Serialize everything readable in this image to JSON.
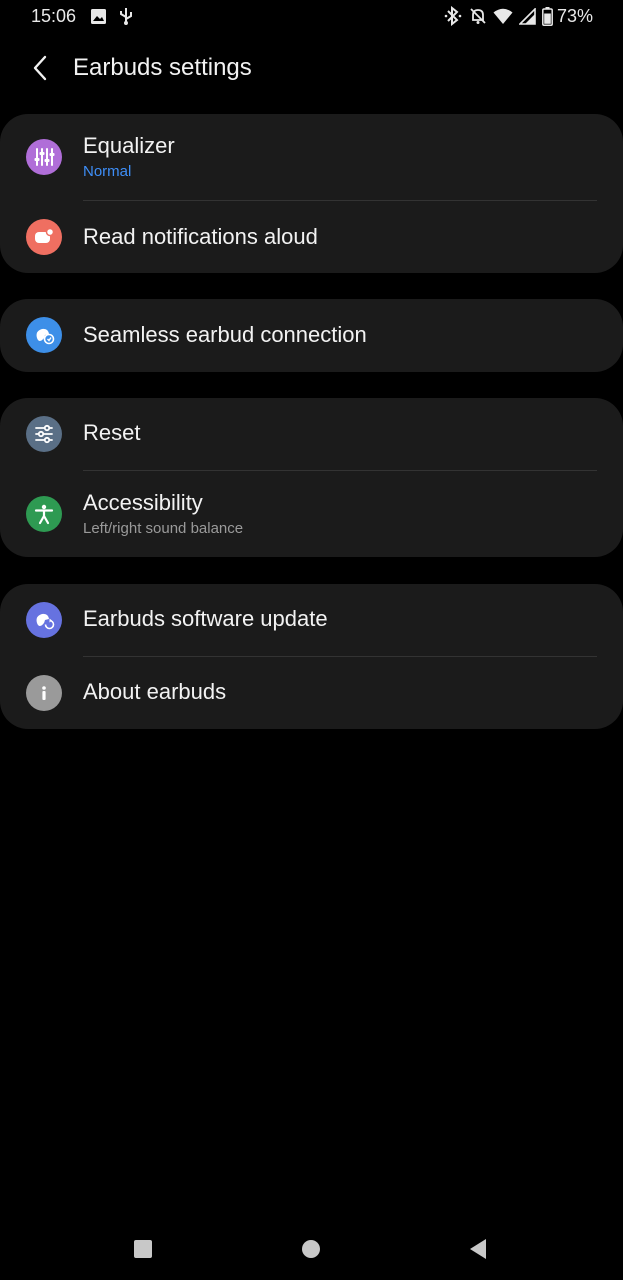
{
  "status_bar": {
    "time": "15:06",
    "battery": "73%",
    "icons": [
      "image-icon",
      "usb-icon",
      "bluetooth-icon",
      "mute-icon",
      "wifi-icon",
      "signal-icon",
      "battery-icon"
    ]
  },
  "header": {
    "title": "Earbuds settings",
    "back_icon": "back-arrow-icon"
  },
  "settings": {
    "equalizer": {
      "title": "Equalizer",
      "subtitle": "Normal",
      "icon": "equalizer-icon",
      "icon_color": "#b06ed8"
    },
    "read_notifications": {
      "title": "Read notifications aloud",
      "icon": "notification-icon",
      "icon_color": "#ef6f61"
    },
    "seamless": {
      "title": "Seamless earbud connection",
      "icon": "earbud-connection-icon",
      "icon_color": "#3d8fe8"
    },
    "reset": {
      "title": "Reset",
      "icon": "sliders-icon",
      "icon_color": "#5a6f86"
    },
    "accessibility": {
      "title": "Accessibility",
      "subtitle": "Left/right sound balance",
      "icon": "accessibility-icon",
      "icon_color": "#2e9a52"
    },
    "software_update": {
      "title": "Earbuds software update",
      "icon": "update-icon",
      "icon_color": "#6672e0"
    },
    "about": {
      "title": "About earbuds",
      "icon": "info-icon",
      "icon_color": "#9a9a9a"
    }
  },
  "colors": {
    "background": "#000000",
    "card": "#1b1b1b",
    "accent_blue": "#3e8ef7",
    "subtitle_gray": "#9a9a9a"
  },
  "nav_bar": {
    "buttons": [
      "recents-icon",
      "home-icon",
      "back-icon"
    ]
  }
}
